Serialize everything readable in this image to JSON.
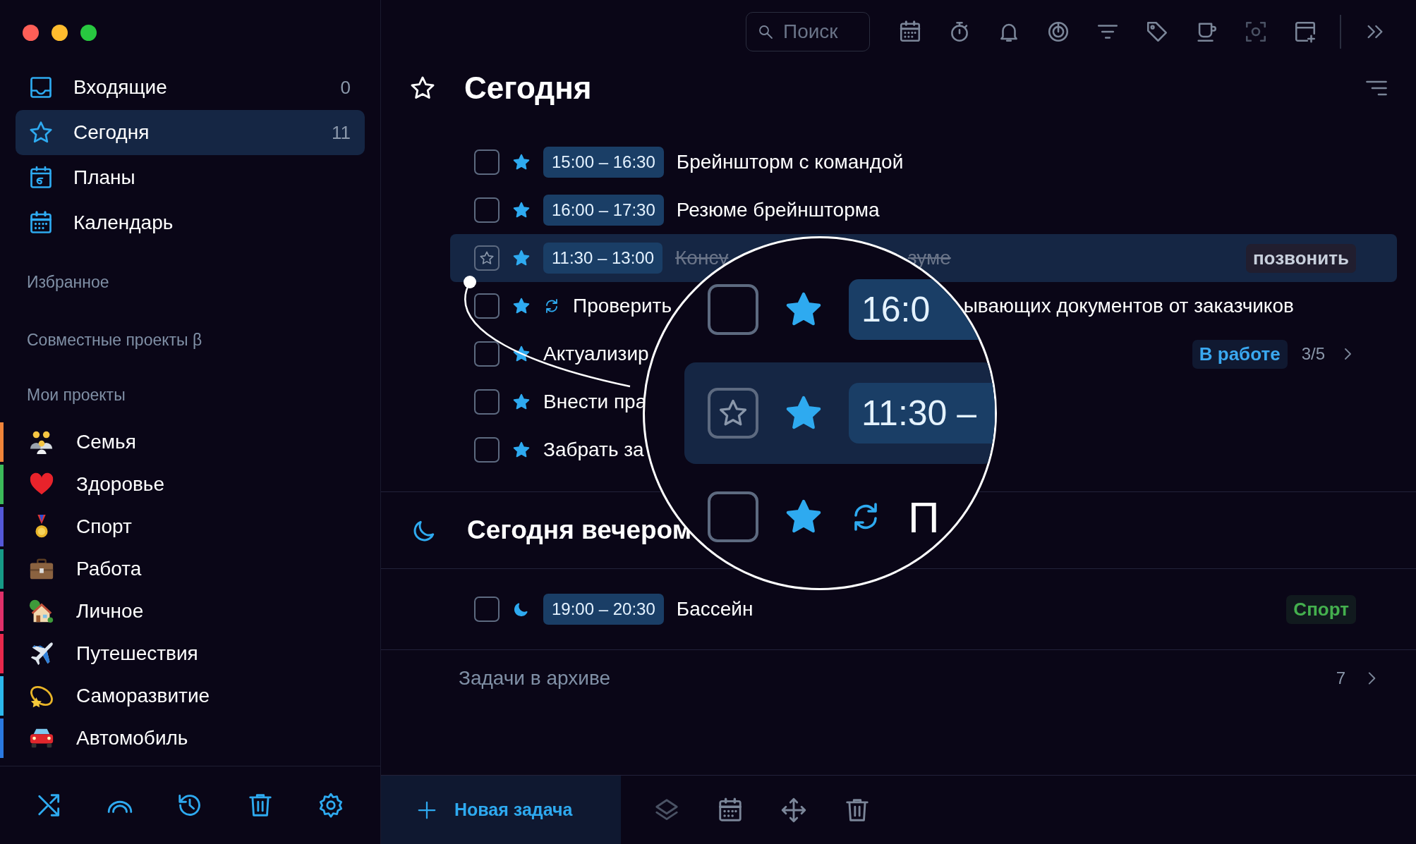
{
  "window": {
    "controls": [
      {
        "color": "#fe5f57"
      },
      {
        "color": "#febc2e"
      },
      {
        "color": "#28c840"
      }
    ]
  },
  "sidebar": {
    "nav": [
      {
        "label": "Входящие",
        "count": "0",
        "selected": false
      },
      {
        "label": "Сегодня",
        "count": "11",
        "selected": true
      },
      {
        "label": "Планы",
        "selected": false
      },
      {
        "label": "Календарь",
        "selected": false
      }
    ],
    "sections": [
      "Избранное",
      "Совместные проекты β",
      "Мои проекты"
    ],
    "projects": [
      {
        "label": "Семья",
        "color": "#f0843a"
      },
      {
        "label": "Здоровье",
        "color": "#3cba5a"
      },
      {
        "label": "Спорт",
        "color": "#5458d8"
      },
      {
        "label": "Работа",
        "color": "#169a86"
      },
      {
        "label": "Личное",
        "color": "#e0306a"
      },
      {
        "label": "Путешествия",
        "color": "#e8284c"
      },
      {
        "label": "Саморазвитие",
        "color": "#2cb8ec"
      },
      {
        "label": "Автомобиль",
        "color": "#2a78e0"
      }
    ]
  },
  "toolbar": {
    "search": {
      "placeholder": "Поиск"
    }
  },
  "header": {
    "title": "Сегодня"
  },
  "tasks": [
    {
      "selected": false,
      "done": false,
      "checked": false,
      "kind": "star",
      "repeat": false,
      "time": "15:00 – 16:30",
      "title": "Брейншторм с командой"
    },
    {
      "selected": false,
      "done": false,
      "checked": false,
      "kind": "star",
      "repeat": false,
      "time": "16:00 – 17:30",
      "title": "Резюме брейншторма"
    },
    {
      "selected": true,
      "done": true,
      "kind": "star",
      "repeat": false,
      "time": "11:30 – 13:00",
      "title": "Консу",
      "title_end": "зуме",
      "tag": {
        "label": "позвонить",
        "color": "#c8d0dc"
      }
    },
    {
      "selected": false,
      "done": false,
      "checked": false,
      "kind": "star",
      "repeat": true,
      "title": "Проверить",
      "title_end": "ывающих документов от заказчиков"
    },
    {
      "selected": false,
      "done": false,
      "checked": false,
      "kind": "star",
      "repeat": false,
      "title": "Актуализир",
      "tag": {
        "label": "В работе",
        "color": "#3aa8f0"
      },
      "progress": "3/5"
    },
    {
      "selected": false,
      "done": false,
      "checked": false,
      "kind": "star",
      "repeat": false,
      "title": "Внести пра"
    },
    {
      "selected": false,
      "done": false,
      "checked": false,
      "kind": "star",
      "repeat": false,
      "title": "Забрать за"
    }
  ],
  "evening": {
    "title": "Сегодня вечером",
    "tasks": [
      {
        "selected": false,
        "done": false,
        "checked": false,
        "kind": "moon",
        "repeat": false,
        "time": "19:00 – 20:30",
        "title": "Бассейн",
        "tag": {
          "label": "Спорт",
          "color": "#44b04e"
        }
      }
    ]
  },
  "archive": {
    "label": "Задачи в архиве",
    "count": "7"
  },
  "bottom_bar": {
    "new_task": "Новая задача"
  },
  "magnifier": {
    "rows": [
      {
        "selected": false,
        "kind": "star",
        "repeat": false,
        "time": "16:0"
      },
      {
        "selected": true,
        "kind": "star",
        "repeat": false,
        "time": "11:30 –"
      },
      {
        "selected": false,
        "kind": "star",
        "repeat": true,
        "title": "П"
      }
    ]
  }
}
